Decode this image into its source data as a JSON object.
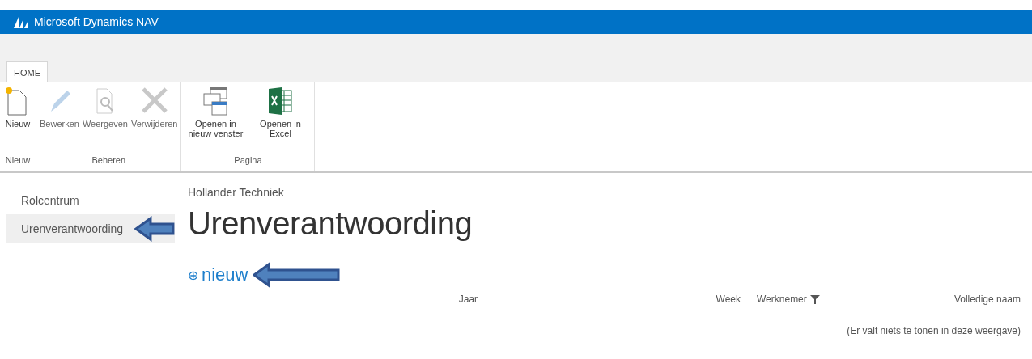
{
  "app": {
    "title": "Microsoft Dynamics NAV"
  },
  "ribbon_tabs": [
    {
      "label": "HOME",
      "selected": true
    }
  ],
  "ribbon_groups": [
    {
      "label": "Nieuw",
      "buttons": [
        {
          "kind": "new",
          "label": "Nieuw",
          "disabled": false
        }
      ]
    },
    {
      "label": "Beheren",
      "buttons": [
        {
          "kind": "edit",
          "label": "Bewerken",
          "disabled": true
        },
        {
          "kind": "view",
          "label": "Weergeven",
          "disabled": true
        },
        {
          "kind": "delete",
          "label": "Verwijderen",
          "disabled": true
        }
      ]
    },
    {
      "label": "Pagina",
      "buttons": [
        {
          "kind": "window",
          "label": "Openen in nieuw venster",
          "disabled": false
        },
        {
          "kind": "excel",
          "label": "Openen in Excel",
          "disabled": false
        }
      ]
    }
  ],
  "sidebar": {
    "items": [
      {
        "label": "Rolcentrum",
        "selected": false
      },
      {
        "label": "Urenverantwoording",
        "selected": true
      }
    ]
  },
  "page": {
    "company": "Hollander Techniek",
    "title": "Urenverantwoording",
    "new_action": {
      "icon": "⊕",
      "label": "nieuw"
    }
  },
  "table": {
    "columns": [
      {
        "label": "Jaar",
        "filtered": false
      },
      {
        "label": "Week",
        "filtered": false
      },
      {
        "label": "Werknemer",
        "filtered": true
      },
      {
        "label": "Volledige naam",
        "filtered": false
      }
    ],
    "empty_message": "(Er valt niets te tonen in deze weergave)"
  }
}
